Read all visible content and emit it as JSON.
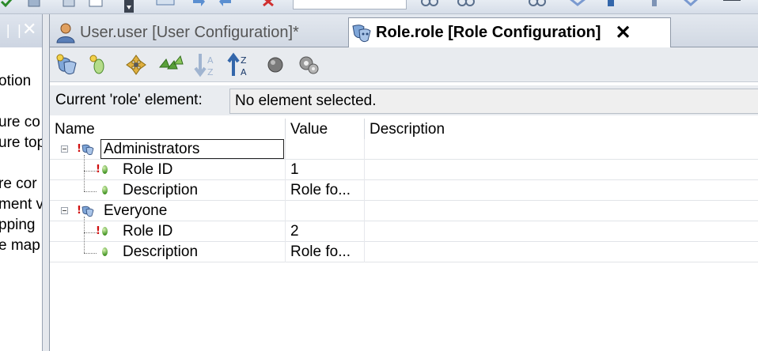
{
  "left_panel": {
    "lines": [
      "otion",
      "",
      "ure co",
      "ure top",
      "",
      "re cor",
      "ment v",
      "pping",
      "e map"
    ]
  },
  "tabs": [
    {
      "label": "User.user [User Configuration]*",
      "icon": "user-icon",
      "active": false
    },
    {
      "label": "Role.role [Role Configuration]",
      "icon": "role-masks-icon",
      "active": true,
      "close_label": "✕"
    }
  ],
  "current_element": {
    "label": "Current 'role' element:",
    "value": "No element selected."
  },
  "grid": {
    "columns": [
      "Name",
      "Value",
      "Description"
    ],
    "rows": [
      {
        "name": "Administrators",
        "value": "",
        "description": "",
        "level": 0,
        "expander": "⊟"
      },
      {
        "name": "Role ID",
        "value": "1",
        "description": "",
        "level": 1,
        "required": true
      },
      {
        "name": "Description",
        "value": "Role fo...",
        "description": "",
        "level": 1,
        "required": false
      },
      {
        "name": "Everyone",
        "value": "",
        "description": "",
        "level": 0,
        "expander": "⊟"
      },
      {
        "name": "Role ID",
        "value": "2",
        "description": "",
        "level": 1,
        "required": true
      },
      {
        "name": "Description",
        "value": "Role fo...",
        "description": "",
        "level": 1,
        "required": false
      }
    ]
  },
  "colors": {
    "required_marker": "#d01010",
    "leaf_dot": "#4a9a2a",
    "toolbar_bg": "#e8ebef"
  }
}
